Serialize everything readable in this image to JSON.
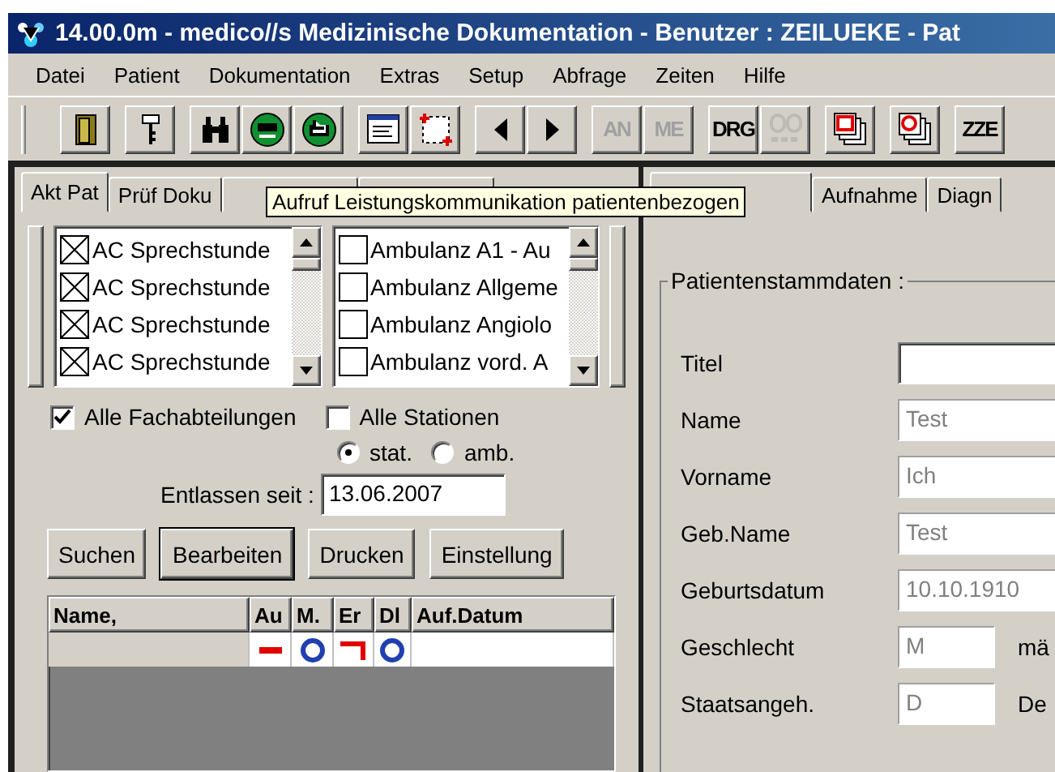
{
  "window": {
    "title": "14.00.0m - medico//s Medizinische Dokumentation - Benutzer : ZEILUEKE - Pat"
  },
  "menu": [
    "Datei",
    "Patient",
    "Dokumentation",
    "Extras",
    "Setup",
    "Abfrage",
    "Zeiten",
    "Hilfe"
  ],
  "toolbar": [
    {
      "kind": "icon",
      "disabled": false
    },
    {
      "kind": "icon",
      "disabled": false
    },
    {
      "kind": "icon",
      "disabled": false
    },
    {
      "kind": "icon",
      "disabled": false
    },
    {
      "kind": "icon",
      "disabled": false
    },
    {
      "kind": "icon",
      "disabled": false
    },
    {
      "kind": "icon",
      "disabled": false
    },
    {
      "kind": "icon",
      "disabled": false
    },
    {
      "kind": "icon",
      "disabled": false
    },
    {
      "kind": "text",
      "label": "AN",
      "disabled": true
    },
    {
      "kind": "text",
      "label": "ME",
      "disabled": true
    },
    {
      "kind": "text",
      "label": "DRG",
      "disabled": false
    },
    {
      "kind": "icon",
      "disabled": true
    },
    {
      "kind": "icon",
      "disabled": false
    },
    {
      "kind": "icon",
      "disabled": false
    },
    {
      "kind": "text",
      "label": "ZZE",
      "disabled": false
    }
  ],
  "left_tabs": [
    {
      "label": "Akt Pat",
      "selected": true
    },
    {
      "label": "Prüf Doku",
      "selected": false
    },
    {
      "selected": false
    },
    {
      "selected": false
    }
  ],
  "tooltip": "Aufruf Leistungskommunikation patientenbezogen",
  "departments": [
    {
      "label": "AC Sprechstunde",
      "checked": true
    },
    {
      "label": "AC Sprechstunde",
      "checked": true
    },
    {
      "label": "AC Sprechstunde",
      "checked": true
    },
    {
      "label": "AC Sprechstunde",
      "checked": true
    }
  ],
  "stations": [
    {
      "label": "Ambulanz A1 - Au",
      "checked": false
    },
    {
      "label": "Ambulanz Allgeme",
      "checked": false
    },
    {
      "label": "Ambulanz Angiolo",
      "checked": false
    },
    {
      "label": "Ambulanz vord. A",
      "checked": false
    }
  ],
  "options": [
    {
      "label": "Alle Fachabteilungen",
      "checked": true
    },
    {
      "label": "Alle Stationen",
      "checked": false
    }
  ],
  "radios": [
    {
      "label": "stat.",
      "selected": true
    },
    {
      "label": "amb.",
      "selected": false
    }
  ],
  "discharged": {
    "label": "Entlassen seit :",
    "value": "13.06.2007"
  },
  "buttons": [
    {
      "label": "Suchen",
      "default": false
    },
    {
      "label": "Bearbeiten",
      "default": true
    },
    {
      "label": "Drucken",
      "default": false
    },
    {
      "label": "Einstellung",
      "default": false
    }
  ],
  "table": {
    "columns": [
      "Name,",
      "Au",
      "M.",
      "Er",
      "Dl",
      "Auf.Datum"
    ],
    "rows": [
      {
        "cells": [
          {
            "kind": "empty"
          },
          {
            "kind": "red-dash"
          },
          {
            "kind": "blue-ring"
          },
          {
            "kind": "red-corner"
          },
          {
            "kind": "blue-ring"
          },
          {
            "kind": "empty"
          }
        ]
      }
    ]
  },
  "right_tabs": [
    {
      "selected": true
    },
    {
      "label": "Aufnahme",
      "selected": false
    },
    {
      "label": "Diagn",
      "selected": false
    }
  ],
  "patient": {
    "title": "Patientenstammdaten :",
    "fields": [
      {
        "label": "Titel",
        "disabled": false
      },
      {
        "label": "Name",
        "value": "Test",
        "disabled": true
      },
      {
        "label": "Vorname",
        "value": "Ich",
        "disabled": true
      },
      {
        "label": "Geb.Name",
        "value": "Test",
        "disabled": true
      },
      {
        "label": "Geburtsdatum",
        "value": "10.10.1910",
        "disabled": true
      },
      {
        "label": "Geschlecht",
        "value": "M",
        "disabled": true,
        "note": "mä"
      },
      {
        "label": "Staatsangeh.",
        "value": "D",
        "disabled": true,
        "note": "De"
      }
    ]
  }
}
